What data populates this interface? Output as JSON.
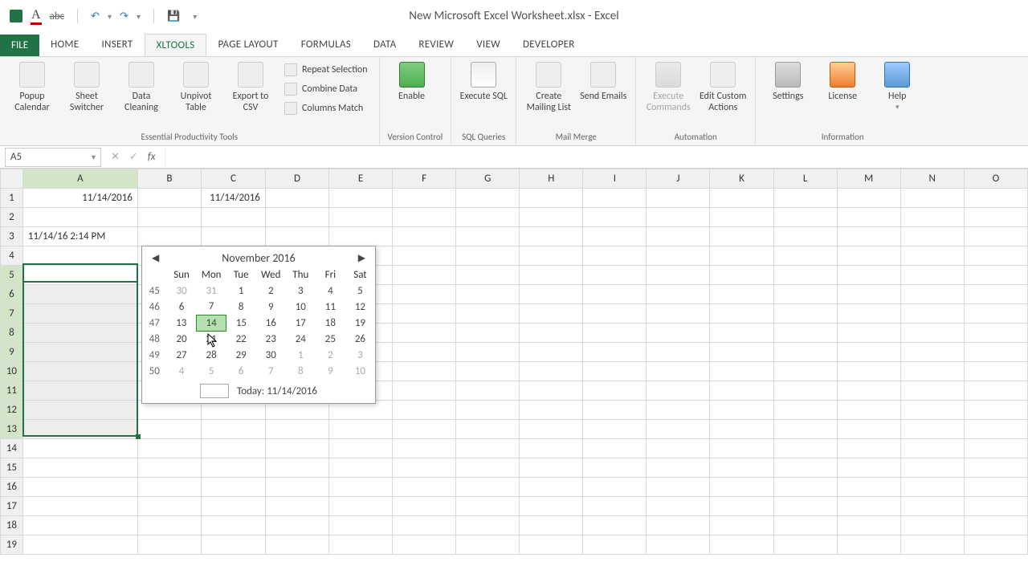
{
  "window": {
    "title": "New Microsoft Excel Worksheet.xlsx - Excel"
  },
  "qat": {
    "fontcolor": "A",
    "strike": "abc"
  },
  "tabs": {
    "file": "FILE",
    "list": [
      "HOME",
      "INSERT",
      "XLTools",
      "PAGE LAYOUT",
      "FORMULAS",
      "DATA",
      "REVIEW",
      "VIEW",
      "DEVELOPER"
    ],
    "active": "XLTools"
  },
  "ribbon": {
    "groups": {
      "essentialTools": {
        "label": "Essential Productivity Tools",
        "popupCalendar": "Popup Calendar",
        "sheetSwitcher": "Sheet Switcher",
        "dataCleaning": "Data Cleaning",
        "unpivotTable": "Unpivot Table",
        "exportCsv": "Export to CSV",
        "repeatSelection": "Repeat Selection",
        "combineData": "Combine Data",
        "columnsMatch": "Columns Match"
      },
      "versionControl": {
        "label": "Version Control",
        "enable": "Enable"
      },
      "sqlQueries": {
        "label": "SQL Queries",
        "executeSql": "Execute SQL"
      },
      "mailMerge": {
        "label": "Mail Merge",
        "createMailingList": "Create Mailing List",
        "sendEmails": "Send Emails"
      },
      "automation": {
        "label": "Automation",
        "executeCommands": "Execute Commands",
        "editCustomActions": "Edit Custom Actions"
      },
      "information": {
        "label": "Information",
        "settings": "Settings",
        "license": "License",
        "help": "Help"
      }
    }
  },
  "formula": {
    "nameBox": "A5",
    "icons": {
      "cancel": "✕",
      "enter": "✓",
      "fx": "fx"
    }
  },
  "grid": {
    "cols": [
      "A",
      "B",
      "C",
      "D",
      "E",
      "F",
      "G",
      "H",
      "I",
      "J",
      "K",
      "L",
      "M",
      "N",
      "O"
    ],
    "colWidths": {
      "A": 144,
      "default": 80
    },
    "rowCount": 19,
    "cells": {
      "A1": "11/14/2016",
      "C1": "11/14/2016",
      "A3": "11/14/16 2:14 PM"
    },
    "selection": {
      "active": "A5",
      "range": "A5:A13"
    }
  },
  "calendar": {
    "title": "November 2016",
    "dayHeaders": [
      "Sun",
      "Mon",
      "Tue",
      "Wed",
      "Thu",
      "Fri",
      "Sat"
    ],
    "weekNums": [
      45,
      46,
      47,
      48,
      49,
      50
    ],
    "rows": [
      [
        {
          "d": 30,
          "o": 1
        },
        {
          "d": 31,
          "o": 1
        },
        {
          "d": 1
        },
        {
          "d": 2
        },
        {
          "d": 3
        },
        {
          "d": 4
        },
        {
          "d": 5
        }
      ],
      [
        {
          "d": 6
        },
        {
          "d": 7
        },
        {
          "d": 8
        },
        {
          "d": 9
        },
        {
          "d": 10
        },
        {
          "d": 11
        },
        {
          "d": 12
        }
      ],
      [
        {
          "d": 13
        },
        {
          "d": 14,
          "t": 1
        },
        {
          "d": 15
        },
        {
          "d": 16
        },
        {
          "d": 17
        },
        {
          "d": 18
        },
        {
          "d": 19
        }
      ],
      [
        {
          "d": 20
        },
        {
          "d": 21
        },
        {
          "d": 22
        },
        {
          "d": 23
        },
        {
          "d": 24
        },
        {
          "d": 25
        },
        {
          "d": 26
        }
      ],
      [
        {
          "d": 27
        },
        {
          "d": 28
        },
        {
          "d": 29
        },
        {
          "d": 30
        },
        {
          "d": 1,
          "o": 1
        },
        {
          "d": 2,
          "o": 1
        },
        {
          "d": 3,
          "o": 1
        }
      ],
      [
        {
          "d": 4,
          "o": 1
        },
        {
          "d": 5,
          "o": 1
        },
        {
          "d": 6,
          "o": 1
        },
        {
          "d": 7,
          "o": 1
        },
        {
          "d": 8,
          "o": 1
        },
        {
          "d": 9,
          "o": 1
        },
        {
          "d": 10,
          "o": 1
        }
      ]
    ],
    "todayLabel": "Today: 11/14/2016"
  }
}
